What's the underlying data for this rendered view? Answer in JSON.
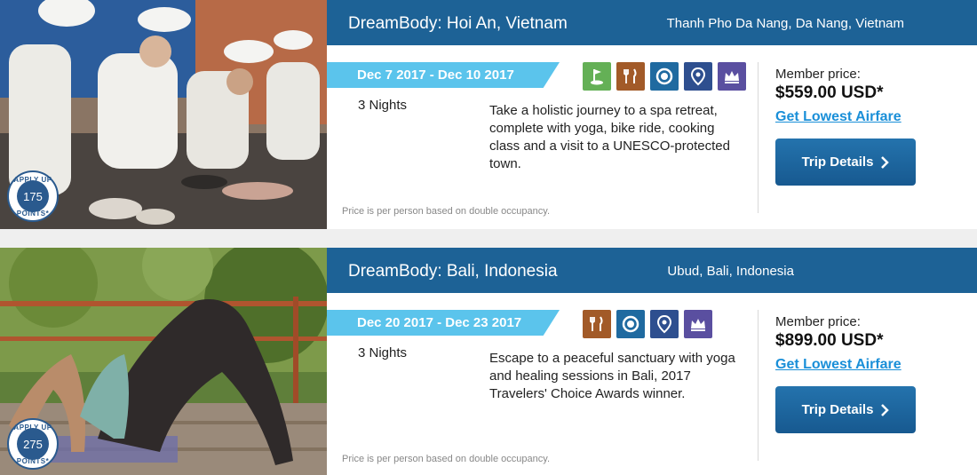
{
  "trips": [
    {
      "title": "DreamBody: Hoi An, Vietnam",
      "location": "Thanh Pho Da Nang, Da Nang, Vietnam",
      "dates": "Dec 7 2017 - Dec 10 2017",
      "nights": "3 Nights",
      "description": "Take a holistic journey to a spa retreat, complete with yoga, bike ride, cooking class and a visit to a UNESCO-protected town.",
      "fine_print": "Price is per person based on double occupancy.",
      "price_label": "Member price:",
      "price": "$559.00 USD*",
      "airfare_link": "Get Lowest Airfare",
      "button_label": "Trip Details",
      "points_ring_top": "APPLY UP TO",
      "points_ring_bottom": "POINTS*",
      "points": "175",
      "amenities": [
        "golf-icon",
        "dining-icon",
        "spa-icon",
        "location-pin-icon",
        "luxury-crown-icon"
      ]
    },
    {
      "title": "DreamBody: Bali, Indonesia",
      "location": "Ubud, Bali, Indonesia",
      "dates": "Dec 20 2017 - Dec 23 2017",
      "nights": "3 Nights",
      "description": "Escape to a peaceful sanctuary with yoga and healing sessions in Bali, 2017 Travelers' Choice Awards winner.",
      "fine_print": "Price is per person based on double occupancy.",
      "price_label": "Member price:",
      "price": "$899.00 USD*",
      "airfare_link": "Get Lowest Airfare",
      "button_label": "Trip Details",
      "points_ring_top": "APPLY UP TO",
      "points_ring_bottom": "POINTS*",
      "points": "275",
      "amenities": [
        "dining-icon",
        "spa-icon",
        "location-pin-icon",
        "luxury-crown-icon"
      ]
    }
  ],
  "colors": {
    "header": "#1d6296",
    "ribbon": "#5bc4ec",
    "button": "#175990",
    "link": "#1a8fd8",
    "golf": "#64b056",
    "dining": "#a25a28",
    "spa": "#1f6aa0",
    "location": "#2e4f8f",
    "luxury": "#5a4fa0"
  }
}
